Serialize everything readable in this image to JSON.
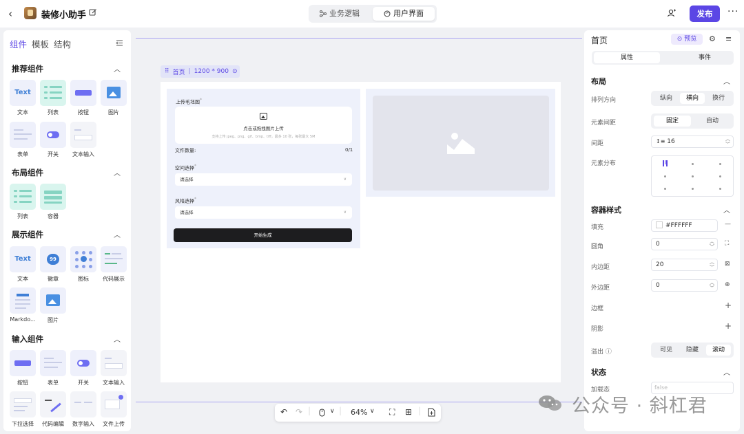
{
  "app": {
    "title": "装修小助手"
  },
  "header": {
    "tabs": [
      "业务逻辑",
      "用户界面"
    ],
    "publish_label": "发布",
    "more_label": "···"
  },
  "left_panel": {
    "tabs": [
      "组件",
      "模板",
      "结构"
    ],
    "sections": [
      {
        "title": "推荐组件",
        "items": [
          "文本",
          "列表",
          "按钮",
          "图片",
          "表单",
          "开关",
          "文本输入"
        ]
      },
      {
        "title": "布局组件",
        "items": [
          "列表",
          "容器"
        ]
      },
      {
        "title": "展示组件",
        "items": [
          "文本",
          "徽章",
          "图标",
          "代码展示",
          "Markdo...",
          "图片"
        ]
      },
      {
        "title": "输入组件",
        "items": [
          "按钮",
          "表单",
          "开关",
          "文本输入",
          "下拉选择",
          "代码编辑",
          "数字输入",
          "文件上传"
        ]
      }
    ],
    "thumb_text": "Text",
    "badge_text": "99",
    "button_text": "Button"
  },
  "canvas": {
    "frame_label": "首页",
    "frame_size": "1200 * 900",
    "form": {
      "upload_label": "上传毛坯图",
      "upload_text": "点击或拖拽图片上传",
      "upload_hint": "支持上传 jpeg、png、gif、bmp、tiff，最多 10 张，每张最大 5M",
      "file_count_label": "文件数量:",
      "file_count": "0/1",
      "space_label": "空间选择",
      "space_placeholder": "请选择",
      "style_label": "风格选择",
      "style_placeholder": "请选择",
      "submit_label": "开始生成"
    },
    "zoom": "64%"
  },
  "right_panel": {
    "title": "首页",
    "preview_label": "预览",
    "tabs": [
      "属性",
      "事件"
    ],
    "layout": {
      "title": "布局",
      "direction_label": "排列方向",
      "direction_options": [
        "纵向",
        "横向",
        "换行"
      ],
      "direction_selected": "横向",
      "spacing_mode_label": "元素间距",
      "spacing_mode_options": [
        "固定",
        "自动"
      ],
      "spacing_mode_selected": "固定",
      "gap_label": "间距",
      "gap_value": "16",
      "distribution_label": "元素分布"
    },
    "container": {
      "title": "容器样式",
      "fill_label": "填充",
      "fill_value": "#FFFFFF",
      "radius_label": "圆角",
      "radius_value": "0",
      "padding_label": "内边距",
      "padding_value": "20",
      "margin_label": "外边距",
      "margin_value": "0",
      "border_label": "边框",
      "shadow_label": "阴影",
      "overflow_label": "溢出",
      "overflow_options": [
        "可见",
        "隐藏",
        "滚动"
      ],
      "overflow_selected": "滚动"
    },
    "state": {
      "title": "状态",
      "loading_label": "加载态",
      "loading_placeholder": "false"
    }
  },
  "watermark": "公众号 · 斜杠君",
  "colors": {
    "accent": "#5b46e5",
    "dark_button": "#1d1d1f",
    "card_bg": "#eef1fb"
  }
}
